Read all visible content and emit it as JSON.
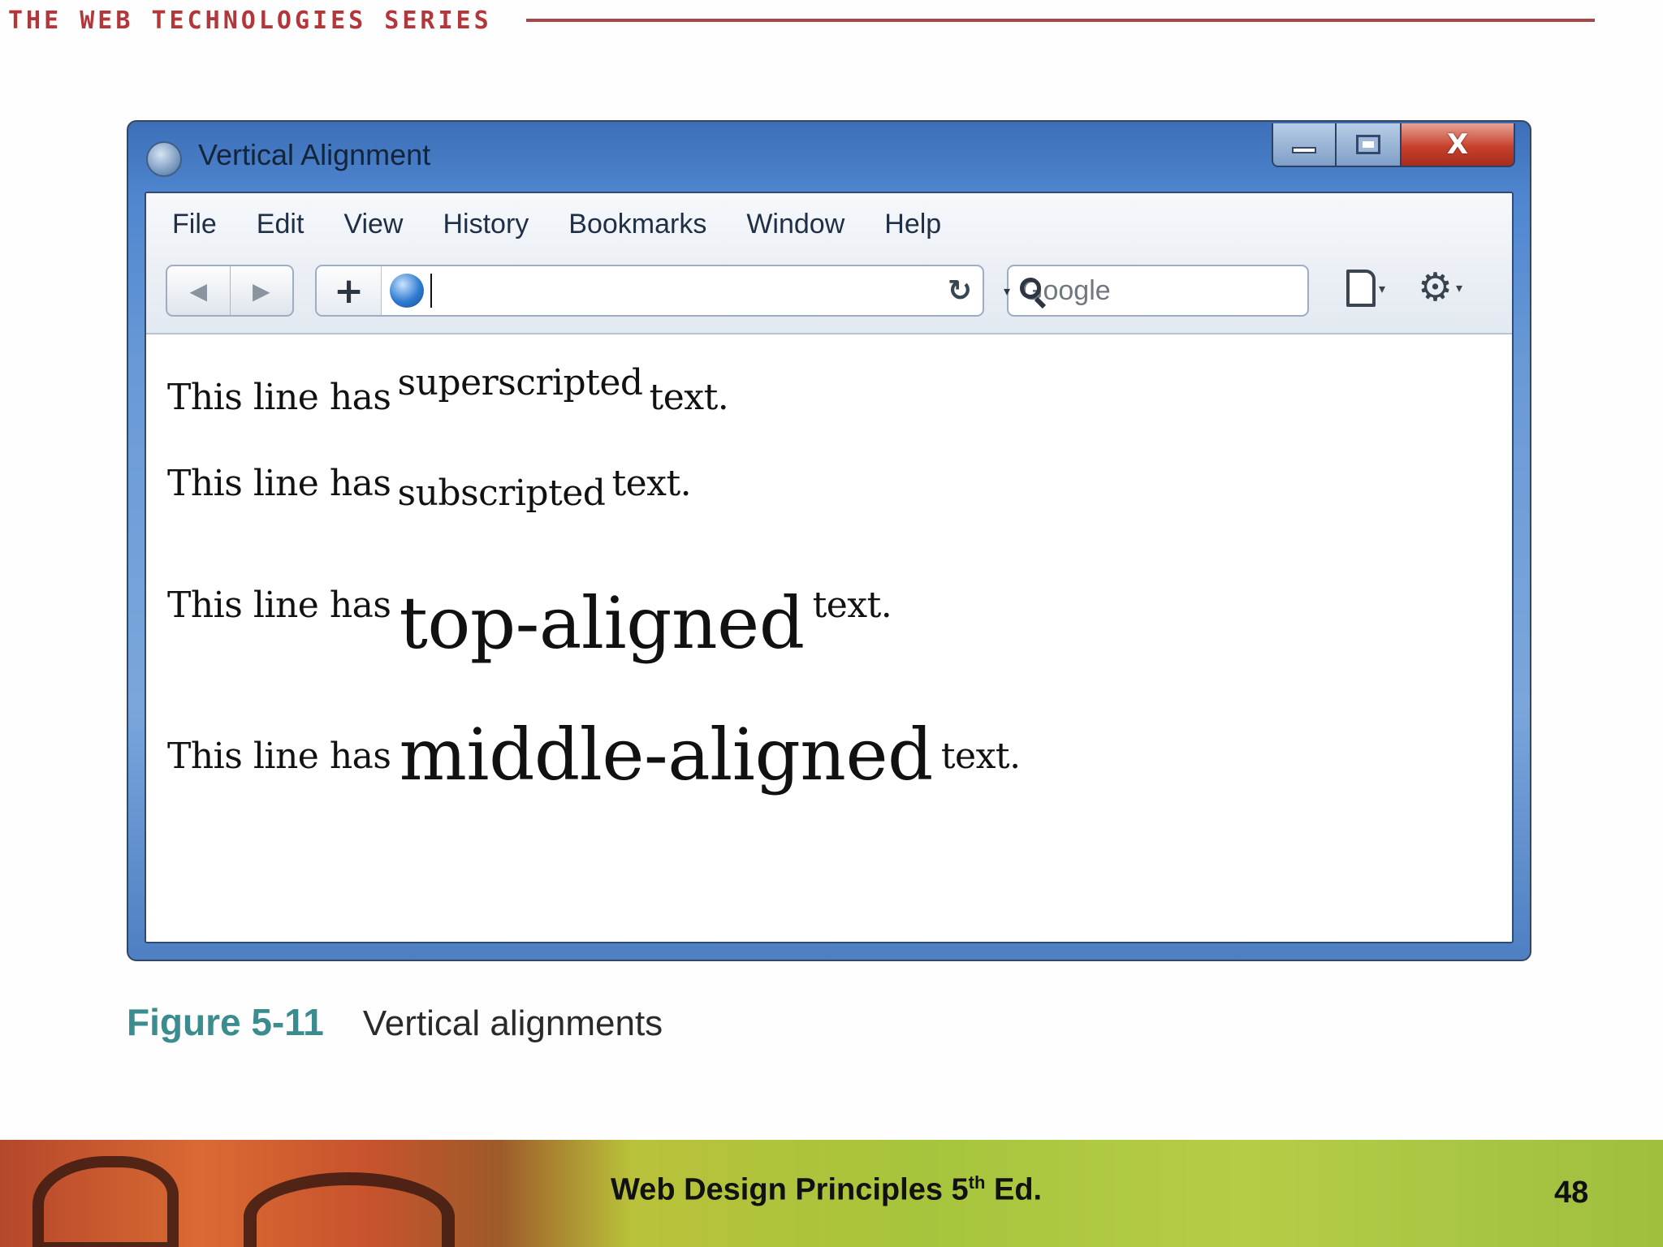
{
  "slide": {
    "series_title": "THE WEB TECHNOLOGIES SERIES",
    "figure_number": "Figure 5-11",
    "figure_caption": "Vertical alignments",
    "footer_title_pre": "Web Design Principles 5",
    "footer_title_sup": "th",
    "footer_title_post": " Ed.",
    "page_number": "48"
  },
  "window": {
    "title": "Vertical Alignment",
    "controls": {
      "minimize_icon": "minimize-icon",
      "maximize_icon": "maximize-icon",
      "close_glyph": "X"
    }
  },
  "menubar": {
    "items": [
      {
        "label": "File"
      },
      {
        "label": "Edit"
      },
      {
        "label": "View"
      },
      {
        "label": "History"
      },
      {
        "label": "Bookmarks"
      },
      {
        "label": "Window"
      },
      {
        "label": "Help"
      }
    ]
  },
  "toolbar": {
    "back_glyph": "◀",
    "forward_glyph": "▶",
    "add_glyph": "+",
    "url_value": "",
    "reload_glyph": "↻",
    "search_placeholder": "Google",
    "dropdown_glyph": "▾",
    "gear_glyph": "⚙"
  },
  "content": {
    "lead": "This line has",
    "tail": "text.",
    "lines": [
      {
        "styled": "superscripted"
      },
      {
        "styled": "subscripted"
      },
      {
        "styled": "top-aligned"
      },
      {
        "styled": "middle-aligned"
      }
    ]
  }
}
